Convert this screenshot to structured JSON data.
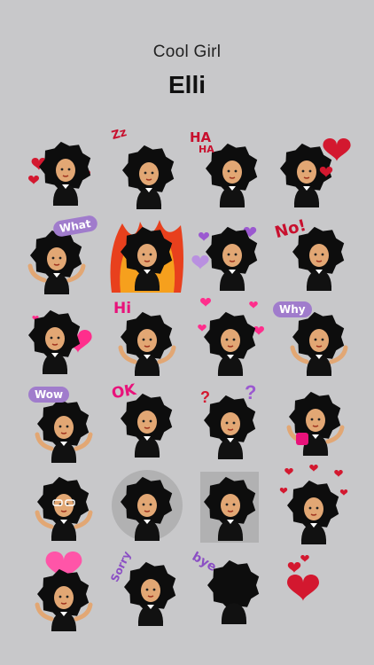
{
  "header": {
    "subtitle": "Cool Girl",
    "title": "Elli"
  },
  "colors": {
    "background": "#c8c8ca",
    "hair": "#0d0d0d",
    "skin": "#e2a774",
    "heart_red": "#d3182f",
    "heart_pink": "#ff2e8c",
    "bubble_purple": "#a07ccc"
  },
  "stickers": [
    {
      "id": "hearts-hug",
      "text": ""
    },
    {
      "id": "sleeping-zzz",
      "text": "Zz"
    },
    {
      "id": "laughing",
      "text": "HA",
      "text2": "HA"
    },
    {
      "id": "big-heart",
      "text": ""
    },
    {
      "id": "what-bubble",
      "text": "What"
    },
    {
      "id": "on-fire",
      "text": ""
    },
    {
      "id": "purple-hearts",
      "text": ""
    },
    {
      "id": "no-shout",
      "text": "No!"
    },
    {
      "id": "pink-heart",
      "text": ""
    },
    {
      "id": "hi-wave",
      "text": "Hi"
    },
    {
      "id": "love-hearts",
      "text": ""
    },
    {
      "id": "why-bubble",
      "text": "Why"
    },
    {
      "id": "wow-bubble",
      "text": "Wow"
    },
    {
      "id": "ok-sign",
      "text": "OK"
    },
    {
      "id": "question-marks",
      "text": ""
    },
    {
      "id": "coffee-sunglasses",
      "text": ""
    },
    {
      "id": "glasses-surprised",
      "text": ""
    },
    {
      "id": "dotted-halo",
      "text": ""
    },
    {
      "id": "rainy-sad",
      "text": ""
    },
    {
      "id": "falling-hearts",
      "text": ""
    },
    {
      "id": "holding-heart",
      "text": ""
    },
    {
      "id": "sorry",
      "text": "Sorry"
    },
    {
      "id": "bye-back",
      "text": "bye"
    },
    {
      "id": "two-hearts",
      "text": ""
    }
  ]
}
